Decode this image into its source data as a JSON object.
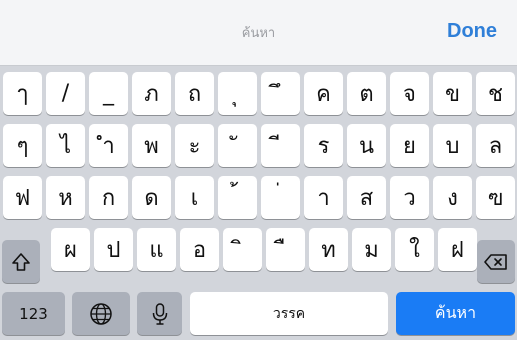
{
  "header": {
    "search_label": "ค้นหา",
    "done_label": "Done"
  },
  "rows": [
    [
      "ๅ",
      "/",
      "_",
      "ภ",
      "ถ",
      "ุ",
      "ึ",
      "ค",
      "ต",
      "จ",
      "ข",
      "ช"
    ],
    [
      "ๆ",
      "ไ",
      "ำ",
      "พ",
      "ะ",
      "ั",
      "ี",
      "ร",
      "น",
      "ย",
      "บ",
      "ล"
    ],
    [
      "ฟ",
      "ห",
      "ก",
      "ด",
      "เ",
      "้",
      "่",
      "า",
      "ส",
      "ว",
      "ง",
      "ฃ"
    ],
    [
      "ผ",
      "ป",
      "แ",
      "อ",
      "ิ",
      "ื",
      "ท",
      "ม",
      "ใ",
      "ฝ"
    ]
  ],
  "bottom_row": {
    "numbers_label": "123",
    "space_label": "วรรค",
    "search_key_label": "ค้นหา"
  },
  "icons": {
    "shift": "shift-icon",
    "delete": "delete-icon",
    "globe": "globe-icon",
    "mic": "microphone-icon"
  },
  "colors": {
    "accent": "#2f7fd8",
    "search_key": "#1a7cf5",
    "keyboard_bg": "#d2d5db",
    "function_key": "#abb0ba"
  }
}
